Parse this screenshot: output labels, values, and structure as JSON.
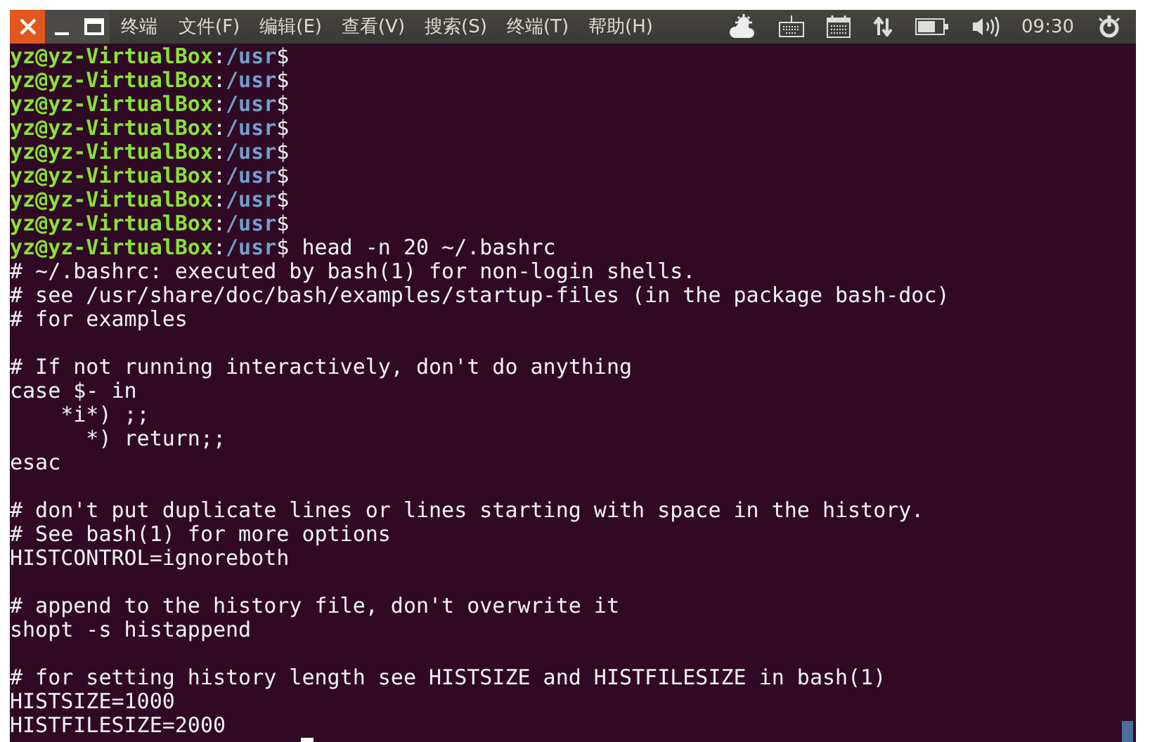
{
  "window": {
    "title": "终端"
  },
  "menu": [
    "文件(F)",
    "编辑(E)",
    "查看(V)",
    "搜索(S)",
    "终端(T)",
    "帮助(H)"
  ],
  "tray": {
    "clock": "09:30"
  },
  "terminal": {
    "lines": [
      {
        "kind": "prompt",
        "segments": [
          {
            "kind": "user",
            "text": "yz@yz-VirtualBox"
          },
          {
            "kind": "plain",
            "text": ":"
          },
          {
            "kind": "path",
            "text": "/usr"
          },
          {
            "kind": "plain",
            "text": "$"
          }
        ]
      },
      {
        "kind": "prompt",
        "segments": [
          {
            "kind": "user",
            "text": "yz@yz-VirtualBox"
          },
          {
            "kind": "plain",
            "text": ":"
          },
          {
            "kind": "path",
            "text": "/usr"
          },
          {
            "kind": "plain",
            "text": "$"
          }
        ]
      },
      {
        "kind": "prompt",
        "segments": [
          {
            "kind": "user",
            "text": "yz@yz-VirtualBox"
          },
          {
            "kind": "plain",
            "text": ":"
          },
          {
            "kind": "path",
            "text": "/usr"
          },
          {
            "kind": "plain",
            "text": "$"
          }
        ]
      },
      {
        "kind": "prompt",
        "segments": [
          {
            "kind": "user",
            "text": "yz@yz-VirtualBox"
          },
          {
            "kind": "plain",
            "text": ":"
          },
          {
            "kind": "path",
            "text": "/usr"
          },
          {
            "kind": "plain",
            "text": "$"
          }
        ]
      },
      {
        "kind": "prompt",
        "segments": [
          {
            "kind": "user",
            "text": "yz@yz-VirtualBox"
          },
          {
            "kind": "plain",
            "text": ":"
          },
          {
            "kind": "path",
            "text": "/usr"
          },
          {
            "kind": "plain",
            "text": "$"
          }
        ]
      },
      {
        "kind": "prompt",
        "segments": [
          {
            "kind": "user",
            "text": "yz@yz-VirtualBox"
          },
          {
            "kind": "plain",
            "text": ":"
          },
          {
            "kind": "path",
            "text": "/usr"
          },
          {
            "kind": "plain",
            "text": "$"
          }
        ]
      },
      {
        "kind": "prompt",
        "segments": [
          {
            "kind": "user",
            "text": "yz@yz-VirtualBox"
          },
          {
            "kind": "plain",
            "text": ":"
          },
          {
            "kind": "path",
            "text": "/usr"
          },
          {
            "kind": "plain",
            "text": "$"
          }
        ]
      },
      {
        "kind": "prompt",
        "segments": [
          {
            "kind": "user",
            "text": "yz@yz-VirtualBox"
          },
          {
            "kind": "plain",
            "text": ":"
          },
          {
            "kind": "path",
            "text": "/usr"
          },
          {
            "kind": "plain",
            "text": "$"
          }
        ]
      },
      {
        "kind": "prompt",
        "segments": [
          {
            "kind": "user",
            "text": "yz@yz-VirtualBox"
          },
          {
            "kind": "plain",
            "text": ":"
          },
          {
            "kind": "path",
            "text": "/usr"
          },
          {
            "kind": "plain",
            "text": "$ head -n 20 ~/.bashrc"
          }
        ]
      },
      {
        "kind": "output",
        "text": "# ~/.bashrc: executed by bash(1) for non-login shells."
      },
      {
        "kind": "output",
        "text": "# see /usr/share/doc/bash/examples/startup-files (in the package bash-doc)"
      },
      {
        "kind": "output",
        "text": "# for examples"
      },
      {
        "kind": "blank"
      },
      {
        "kind": "output",
        "text": "# If not running interactively, don't do anything"
      },
      {
        "kind": "output",
        "text": "case $- in"
      },
      {
        "kind": "output",
        "text": "    *i*) ;;"
      },
      {
        "kind": "output",
        "text": "      *) return;;"
      },
      {
        "kind": "output",
        "text": "esac"
      },
      {
        "kind": "blank"
      },
      {
        "kind": "output",
        "text": "# don't put duplicate lines or lines starting with space in the history."
      },
      {
        "kind": "output",
        "text": "# See bash(1) for more options"
      },
      {
        "kind": "output",
        "text": "HISTCONTROL=ignoreboth"
      },
      {
        "kind": "blank"
      },
      {
        "kind": "output",
        "text": "# append to the history file, don't overwrite it"
      },
      {
        "kind": "output",
        "text": "shopt -s histappend"
      },
      {
        "kind": "blank"
      },
      {
        "kind": "output",
        "text": "# for setting history length see HISTSIZE and HISTFILESIZE in bash(1)"
      },
      {
        "kind": "output",
        "text": "HISTSIZE=1000"
      },
      {
        "kind": "output",
        "text": "HISTFILESIZE=2000"
      }
    ]
  }
}
